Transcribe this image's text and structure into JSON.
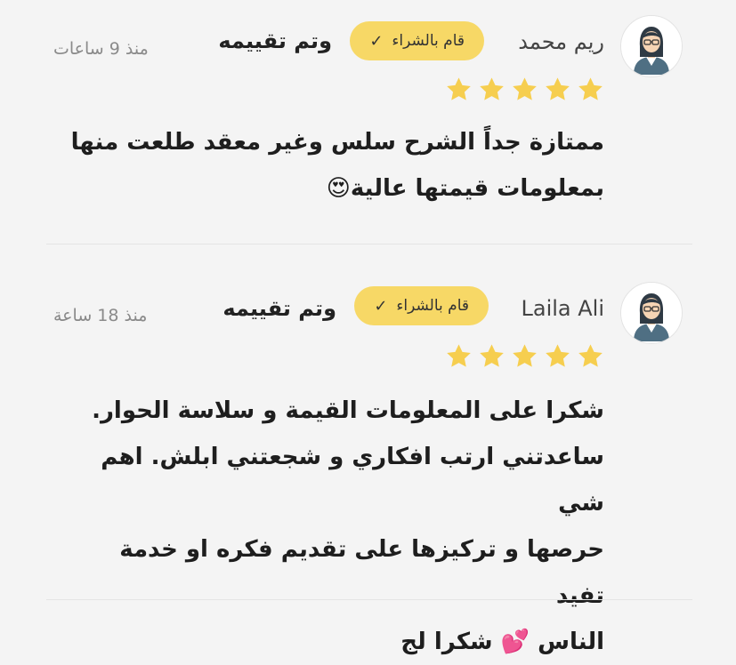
{
  "reviews": [
    {
      "name": "ريم محمد",
      "badge": "قام بالشراء",
      "badge_icon": "check-icon",
      "rated_label": "وتم تقييمه",
      "time": "منذ 9 ساعات",
      "stars": 5,
      "lines": [
        "ممتازة جداً الشرح سلس وغير معقد طلعت منها",
        "بمعلومات قيمتها عالية😍"
      ]
    },
    {
      "name": "Laila Ali",
      "badge": "قام بالشراء",
      "badge_icon": "check-icon",
      "rated_label": "وتم تقييمه",
      "time": "منذ 18 ساعة",
      "stars": 5,
      "lines": [
        "شكرا على المعلومات القيمة و سلاسة الحوار.",
        "ساعدتني ارتب افكاري و شجعتني ابلش. اهم شي",
        "حرصها و تركيزها على تقديم فكره او خدمة تفيد",
        "الناس 💕 شكرا لج"
      ]
    }
  ],
  "colors": {
    "background": "#f4f4f4",
    "badge": "#f7d866",
    "star": "#f6ce4f",
    "muted_text": "#8a8a8a"
  }
}
